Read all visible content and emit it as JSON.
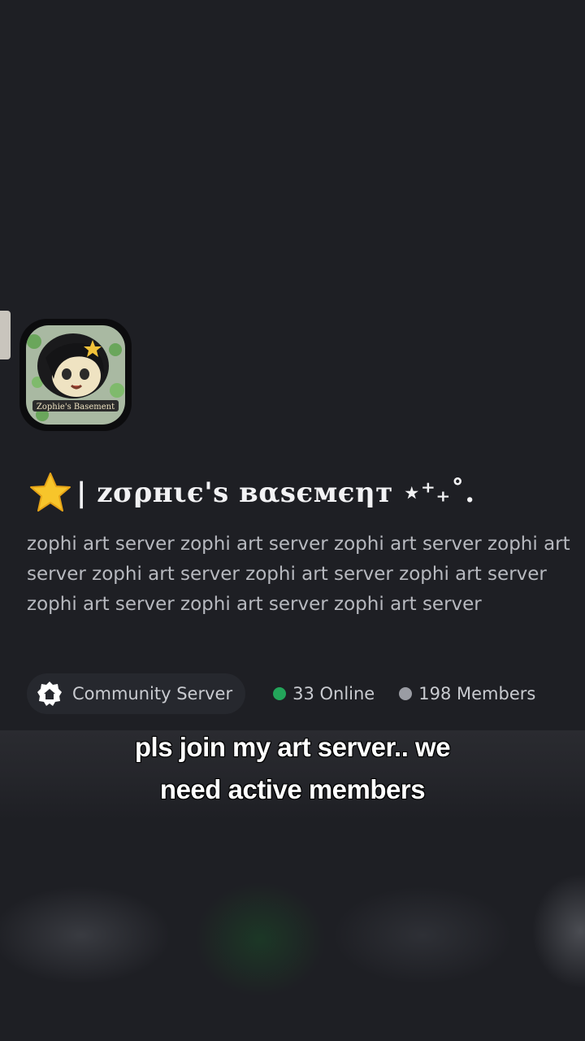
{
  "server": {
    "name_text": "| zσρнιє's вαѕємєηт ⋆⁺₊˚.",
    "description": "zophi art server zophi art server zophi art server zophi art server zophi art server zophi art server zophi art server zophi art server zophi art server zophi art server",
    "icon": "server-avatar-anime-girl",
    "leading_emoji": "star-emoji"
  },
  "info": {
    "type_label": "Community Server",
    "online_label": "33 Online",
    "members_label": "198 Members",
    "online_color": "#23a55a",
    "members_color": "#9a9ca3"
  },
  "caption": {
    "line1": "pls join my art server.. we",
    "line2": "need active members"
  },
  "colors": {
    "background": "#1e1f24",
    "pill": "#26282e"
  }
}
